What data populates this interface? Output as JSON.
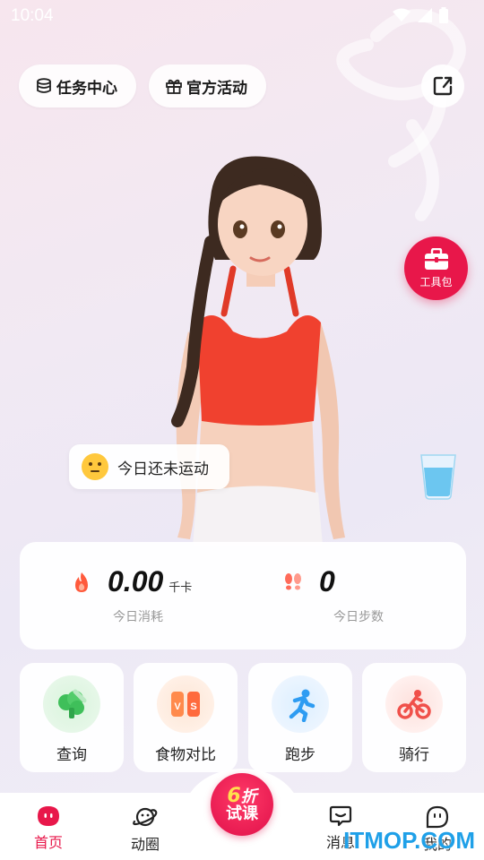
{
  "status_bar": {
    "time": "10:04"
  },
  "header": {
    "task_center_label": "任务中心",
    "activities_label": "官方活动"
  },
  "toolbox": {
    "label": "工具包"
  },
  "activity_status": {
    "text": "今日还未运动"
  },
  "stats": {
    "calories": {
      "value": "0.00",
      "unit": "千卡",
      "label": "今日消耗"
    },
    "steps": {
      "value": "0",
      "label": "今日步数"
    }
  },
  "features": [
    {
      "label": "查询",
      "icon": "broccoli-icon"
    },
    {
      "label": "食物对比",
      "icon": "versus-icon"
    },
    {
      "label": "跑步",
      "icon": "runner-icon"
    },
    {
      "label": "骑行",
      "icon": "cyclist-icon"
    }
  ],
  "promo": {
    "number": "6",
    "top_text": "折",
    "bottom_text": "试课"
  },
  "nav": [
    {
      "label": "首页",
      "icon": "home-icon",
      "active": true
    },
    {
      "label": "动圈",
      "icon": "planet-icon"
    },
    {
      "label": "消息",
      "icon": "message-icon"
    },
    {
      "label": "我的",
      "icon": "profile-icon"
    }
  ],
  "watermark": "ITMOP.COM",
  "colors": {
    "accent": "#e8174a",
    "watermark": "#1fa0e8"
  }
}
